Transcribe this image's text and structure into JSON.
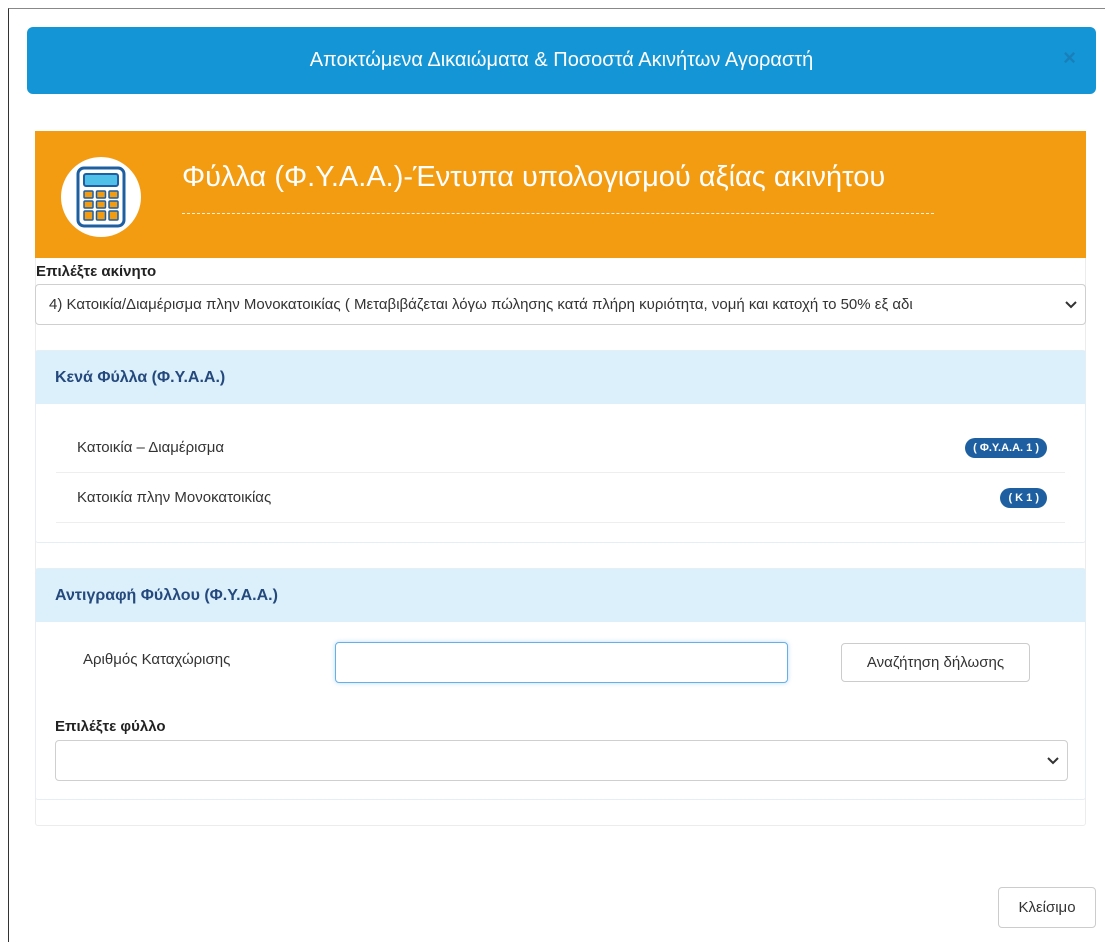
{
  "modal": {
    "title": "Αποκτώμενα Δικαιώματα & Ποσοστά Ακινήτων Αγοραστή",
    "close_glyph": "×"
  },
  "banner": {
    "title": "Φύλλα (Φ.Υ.Α.Α.)-Έντυπα υπολογισμού αξίας ακινήτου",
    "icon": "calculator-icon",
    "color": "#f39c12"
  },
  "property_select": {
    "label": "Επιλέξτε ακίνητο",
    "value": "4) Κατοικία/Διαμέρισμα πλην Μονοκατοικίας ( Μεταβιβάζεται λόγω πώλησης κατά πλήρη κυριότητα, νομή και κατοχή το 50% εξ αδι"
  },
  "blank_sheets": {
    "heading": "Κενά Φύλλα (Φ.Υ.Α.Α.)",
    "items": [
      {
        "label": "Κατοικία – Διαμέρισμα",
        "badge": "( Φ.Υ.Α.Α. 1 )"
      },
      {
        "label": "Κατοικία πλην Μονοκατοικίας",
        "badge": "( Κ 1 )"
      }
    ]
  },
  "copy_sheet": {
    "heading": "Αντιγραφή Φύλλου (Φ.Υ.Α.Α.)",
    "registration_label": "Αριθμός Καταχώρισης",
    "registration_value": "",
    "search_button": "Αναζήτηση δήλωσης",
    "sheet_label": "Επιλέξτε φύλλο",
    "sheet_value": ""
  },
  "footer": {
    "close_button": "Κλείσιμο"
  },
  "colors": {
    "header_blue": "#1495d6",
    "panel_head": "#dcf0fb",
    "heading_text": "#25497d",
    "badge": "#1d5fa0"
  }
}
